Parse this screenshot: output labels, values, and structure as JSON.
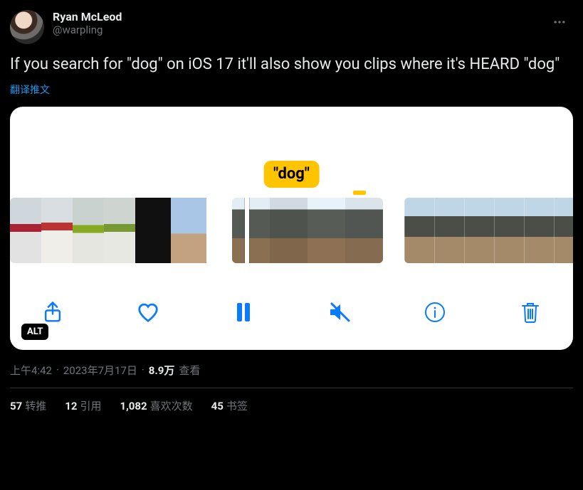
{
  "author": {
    "display_name": "Ryan McLeod",
    "handle": "@warpling"
  },
  "tweet_text": "If you search for \"dog\" on iOS 17 it'll also show you clips where it's HEARD \"dog\"",
  "translate_label": "翻译推文",
  "media": {
    "bubble_text": "\"dog\"",
    "alt_badge": "ALT"
  },
  "meta": {
    "time": "上午4:42",
    "date": "2023年7月17日",
    "views_count": "8.9万",
    "views_label": "查看"
  },
  "stats": {
    "retweets_count": "57",
    "retweets_label": "转推",
    "quotes_count": "12",
    "quotes_label": "引用",
    "likes_count": "1,082",
    "likes_label": "喜欢次数",
    "bookmarks_count": "45",
    "bookmarks_label": "书签"
  }
}
